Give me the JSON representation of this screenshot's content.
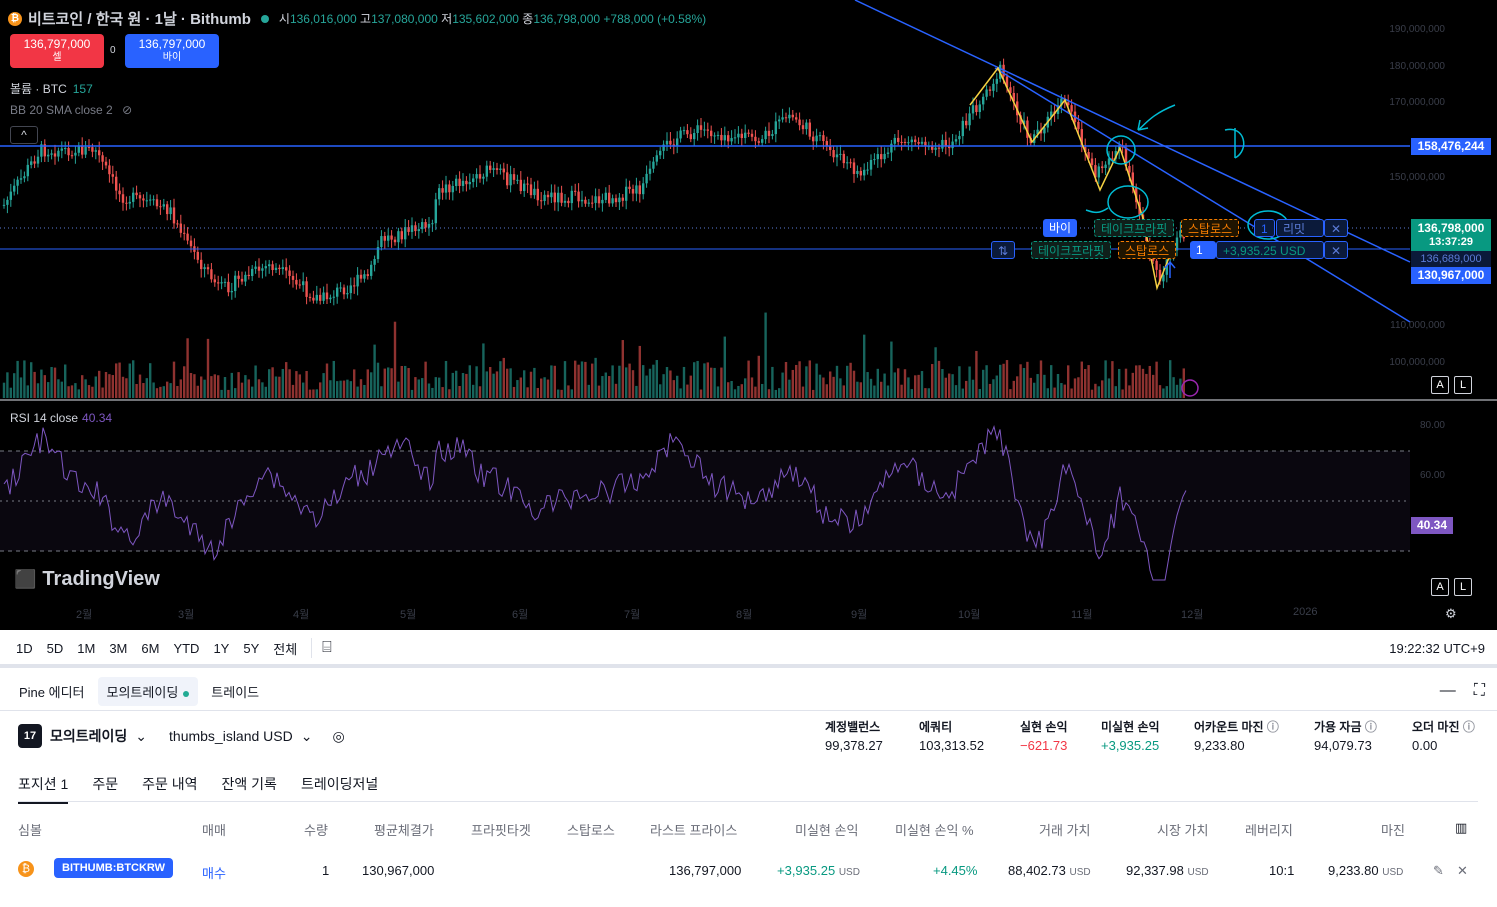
{
  "header": {
    "title": "비트코인 / 한국 원 · 1날 · Bithumb",
    "open_label": "시",
    "open": "136,016,000",
    "high_label": "고",
    "high": "137,080,000",
    "low_label": "저",
    "low": "135,602,000",
    "close_label": "종",
    "close": "136,798,000",
    "change": "+788,000 (+0.58%)"
  },
  "trade_buttons": {
    "sell_price": "136,797,000",
    "sell_label": "셀",
    "spread": "0",
    "buy_price": "136,797,000",
    "buy_label": "바이"
  },
  "indicators": {
    "volume_label": "볼륨 · BTC",
    "volume_value": "157",
    "bb_label": "BB 20 SMA close 2",
    "rsi_label": "RSI 14 close",
    "rsi_value": "40.34"
  },
  "price_axis": {
    "ticks": [
      "190,000,000",
      "180,000,000",
      "170,000,000",
      "150,000,000",
      "110,000,000",
      "100,000,000"
    ],
    "line_label": "158,476,244",
    "current_price": "136,798,000",
    "countdown": "13:37:29",
    "bid_label": "136,689,000",
    "entry_label": "130,967,000"
  },
  "rsi_axis": {
    "ticks": [
      "80.00",
      "60.00"
    ],
    "value": "40.34"
  },
  "months": [
    "2월",
    "3월",
    "4월",
    "5월",
    "6월",
    "7월",
    "8월",
    "9월",
    "10월",
    "11월",
    "12월",
    "2026"
  ],
  "order_tags": {
    "buy": "바이",
    "take_profit_1": "테이크프라핏",
    "stop_loss_1": "스탑로스",
    "qty_1": "1",
    "limit": "리밋",
    "reverse": "⇅",
    "take_profit_2": "테이크프라핏",
    "stop_loss_2": "스탑로스",
    "qty_2": "1",
    "pnl": "+3,935.25 USD",
    "close_x": "✕"
  },
  "chart_btns": {
    "auto": "A",
    "log": "L"
  },
  "tv_brand": "TradingView",
  "periods": [
    "1D",
    "5D",
    "1M",
    "3M",
    "6M",
    "YTD",
    "1Y",
    "5Y",
    "전체"
  ],
  "clock": "19:22:32 UTC+9",
  "panel_tabs": {
    "pine": "Pine 에디터",
    "paper": "모의트레이딩",
    "trade": "트레이드"
  },
  "account": {
    "broker": "모의트레이딩",
    "account_name": "thumbs_island USD"
  },
  "stats": [
    {
      "label": "계정밸런스",
      "value": "99,378.27"
    },
    {
      "label": "에쿼티",
      "value": "103,313.52"
    },
    {
      "label": "실현 손익",
      "value": "−621.73"
    },
    {
      "label": "미실현 손익",
      "value": "+3,935.25"
    },
    {
      "label": "어카운트 마진",
      "value": "9,233.80"
    },
    {
      "label": "가용 자금",
      "value": "94,079.73"
    },
    {
      "label": "오더 마진",
      "value": "0.00"
    }
  ],
  "position_tabs": [
    "포지션 1",
    "주문",
    "주문 내역",
    "잔액 기록",
    "트레이딩저널"
  ],
  "table": {
    "headers": [
      "심볼",
      "매매",
      "수량",
      "평균체결가",
      "프라핏타겟",
      "스탑로스",
      "라스트 프라이스",
      "미실현 손익",
      "미실현 손익 %",
      "거래 가치",
      "시장 가치",
      "레버리지",
      "마진"
    ],
    "row": {
      "symbol": "BITHUMB:BTCKRW",
      "side": "매수",
      "qty": "1",
      "avg_price": "130,967,000",
      "last_price": "136,797,000",
      "upnl": "+3,935.25",
      "upnl_unit": "USD",
      "upnl_pct": "+4.45%",
      "trade_value": "88,402.73",
      "trade_value_unit": "USD",
      "market_value": "92,337.98",
      "market_value_unit": "USD",
      "leverage": "10:1",
      "margin": "9,233.80",
      "margin_unit": "USD"
    }
  },
  "colors": {
    "up": "#26a69a",
    "down": "#ef5350",
    "line": "#2962ff",
    "rsi": "#7e57c2",
    "zigzag": "#f5d142",
    "annot": "#00bcd4"
  }
}
